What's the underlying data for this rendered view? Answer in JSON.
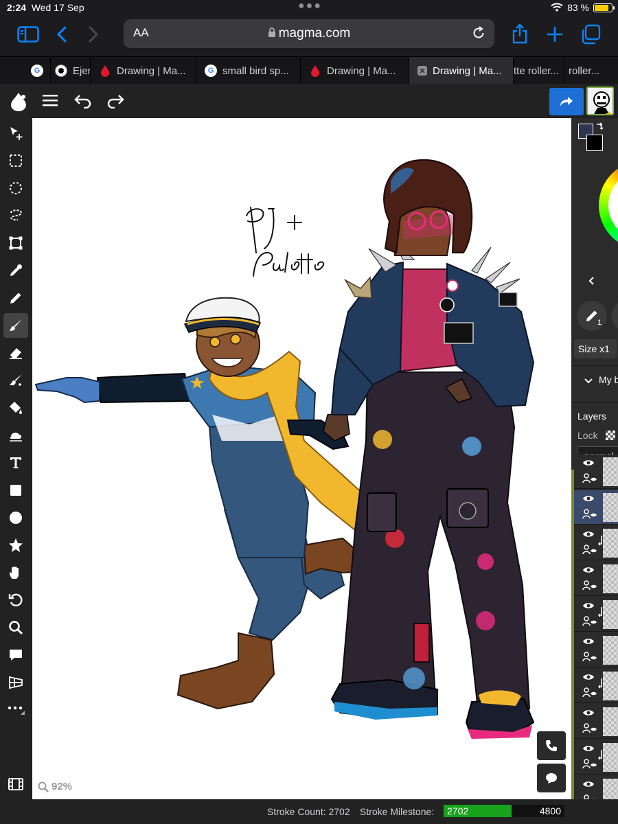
{
  "status_bar": {
    "time": "2:24",
    "date": "Wed 17 Sep",
    "battery_percent": "83 %",
    "battery_level": 0.83,
    "battery_color": "#ffcc00"
  },
  "browser": {
    "text_size_label": "AA",
    "url": "magma.com",
    "accent_color": "#0a84ff",
    "tabs": [
      {
        "title": "",
        "icon": "google-icon",
        "active": false
      },
      {
        "title": "Ejer",
        "icon": "chatgpt-icon",
        "active": false
      },
      {
        "title": "Drawing | Ma...",
        "icon": "magma-icon",
        "active": false
      },
      {
        "title": "small bird sp...",
        "icon": "google-icon",
        "active": false
      },
      {
        "title": "Drawing | Ma...",
        "icon": "magma-icon",
        "active": false
      },
      {
        "title": "Drawing | Ma...",
        "icon": "close-icon",
        "active": true
      },
      {
        "title": "tte roller...",
        "icon": "",
        "active": false
      },
      {
        "title": "roller...",
        "icon": "",
        "active": false
      }
    ]
  },
  "app_header": {
    "icons": [
      "magma-logo-icon",
      "menu-icon",
      "undo-icon",
      "redo-icon",
      "share-icon",
      "user-avatar"
    ],
    "share_color": "#1d6fd6"
  },
  "tools": [
    "move-tool-icon",
    "rect-select-icon",
    "ellipse-select-icon",
    "lasso-icon",
    "transform-icon",
    "eyedropper-icon",
    "pencil-icon",
    "brush-icon",
    "eraser-icon",
    "smudge-icon",
    "paint-bucket-icon",
    "blur-icon",
    "text-icon",
    "rectangle-icon",
    "circle-icon",
    "star-icon",
    "hand-icon",
    "rotate-icon",
    "zoom-icon",
    "comment-icon",
    "perspective-icon",
    "more-icon"
  ],
  "canvas": {
    "zoom": "92%",
    "signature_text": "PJ + Palette"
  },
  "right_panel": {
    "brush_size_badge": "1",
    "size_label": "Size x1",
    "brush_group": "My b",
    "layers_label": "Layers",
    "lock_label": "Lock",
    "blend_mode": "normal",
    "layers_count_visible": 10,
    "selected_layer_index": 1
  },
  "bottom_bar": {
    "stroke_count": "Stroke Count: 2702",
    "stroke_milestone_label": "Stroke Milestone:",
    "milestone_current": "2702",
    "milestone_max": "4800",
    "milestone_fraction": 0.5629,
    "milestone_color": "#19a21c"
  }
}
